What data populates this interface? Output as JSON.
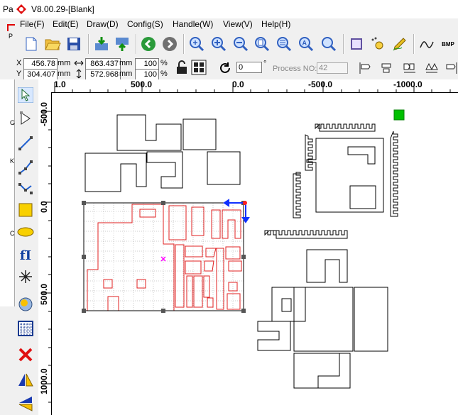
{
  "window": {
    "title": "V8.00.29-[Blank]",
    "title_prefix": "Pa"
  },
  "menu": [
    "File(F)",
    "Edit(E)",
    "Draw(D)",
    "Config(S)",
    "Handle(W)",
    "View(V)",
    "Help(H)"
  ],
  "toolbar_icons": [
    "new-file-icon",
    "open-folder-icon",
    "save-icon",
    "import-icon",
    "export-icon",
    "back-icon",
    "forward-icon",
    "zoom-fit-icon",
    "zoom-in-icon",
    "zoom-out-icon",
    "zoom-page-icon",
    "zoom-select-icon",
    "zoom-auto-icon",
    "zoom-search-icon",
    "frame-icon",
    "node-icon",
    "pen-icon",
    "curve-icon",
    "bmp-icon"
  ],
  "bmp_label": "BMP",
  "position": {
    "x_label": "X",
    "x_value": "456.78",
    "x_unit": "mm",
    "y_label": "Y",
    "y_value": "304.407",
    "y_unit": "mm",
    "w_value": "863.437",
    "w_unit": "mm",
    "h_value": "572.968",
    "h_unit": "mm",
    "w_scale": "100",
    "h_scale": "100",
    "scale_unit": "%"
  },
  "rotation": {
    "value": "0",
    "unit": "°"
  },
  "process": {
    "label": "Process NO:",
    "value": "42"
  },
  "ruler_h": {
    "labels": [
      "1.0",
      "500.0",
      "0.0",
      "-500.0",
      "-1000.0"
    ]
  },
  "ruler_v": {
    "labels": [
      "-500.0",
      "0.0",
      "500.0",
      "1000.0"
    ]
  },
  "left_tools": [
    "select-arrow-icon",
    "node-edit-icon",
    "line-icon",
    "polyline-icon",
    "curve-tool-icon",
    "rectangle-icon",
    "ellipse-icon",
    "text-tool-icon",
    "snowflake-icon",
    "array-icon",
    "grid-icon",
    "delete-icon",
    "mirror-horizontal-icon",
    "mirror-vertical-icon"
  ],
  "left_sub_letters": [
    "P",
    "G",
    "K",
    "C"
  ],
  "text_tool_label": "fI",
  "colors": {
    "selection_red": "#e02020",
    "handle_blue": "#1030ff",
    "marker_green": "#00c000",
    "marker_magenta": "#ff00ff"
  }
}
